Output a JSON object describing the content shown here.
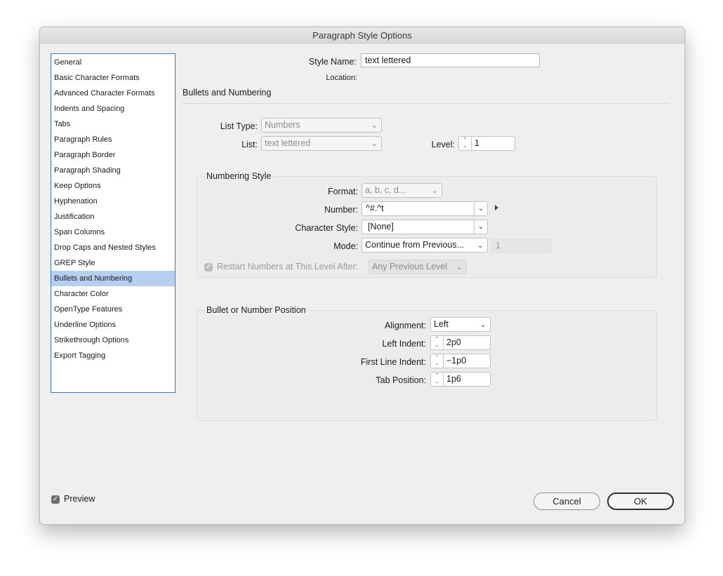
{
  "window": {
    "title": "Paragraph Style Options"
  },
  "sidebar": {
    "items": [
      {
        "label": "General"
      },
      {
        "label": "Basic Character Formats"
      },
      {
        "label": "Advanced Character Formats"
      },
      {
        "label": "Indents and Spacing"
      },
      {
        "label": "Tabs"
      },
      {
        "label": "Paragraph Rules"
      },
      {
        "label": "Paragraph Border"
      },
      {
        "label": "Paragraph Shading"
      },
      {
        "label": "Keep Options"
      },
      {
        "label": "Hyphenation"
      },
      {
        "label": "Justification"
      },
      {
        "label": "Span Columns"
      },
      {
        "label": "Drop Caps and Nested Styles"
      },
      {
        "label": "GREP Style"
      },
      {
        "label": "Bullets and Numbering",
        "selected": true
      },
      {
        "label": "Character Color"
      },
      {
        "label": "OpenType Features"
      },
      {
        "label": "Underline Options"
      },
      {
        "label": "Strikethrough Options"
      },
      {
        "label": "Export Tagging"
      }
    ]
  },
  "header": {
    "style_name_label": "Style Name:",
    "style_name_value": "text lettered",
    "location_label": "Location:",
    "section_title": "Bullets and Numbering"
  },
  "list": {
    "list_type_label": "List Type:",
    "list_type_value": "Numbers",
    "list_label": "List:",
    "list_value": "text lettered",
    "level_label": "Level:",
    "level_value": "1"
  },
  "numbering_style": {
    "title": "Numbering Style",
    "format_label": "Format:",
    "format_value": "a, b, c, d...",
    "number_label": "Number:",
    "number_value": "^#.^t",
    "char_style_label": "Character Style:",
    "char_style_value": "[None]",
    "mode_label": "Mode:",
    "mode_value": "Continue from Previous...",
    "mode_start_value": "1",
    "restart_label": "Restart Numbers at This Level After:",
    "restart_value": "Any Previous Level"
  },
  "position": {
    "title": "Bullet or Number Position",
    "alignment_label": "Alignment:",
    "alignment_value": "Left",
    "left_indent_label": "Left Indent:",
    "left_indent_value": "2p0",
    "first_line_label": "First Line Indent:",
    "first_line_value": "−1p0",
    "tab_position_label": "Tab Position:",
    "tab_position_value": "1p6"
  },
  "footer": {
    "preview_label": "Preview",
    "preview_checked": true,
    "cancel_label": "Cancel",
    "ok_label": "OK"
  },
  "colors": {
    "selection": "#b6cff0",
    "sidebar_border": "#3b78d8",
    "window_bg": "#efefef"
  }
}
